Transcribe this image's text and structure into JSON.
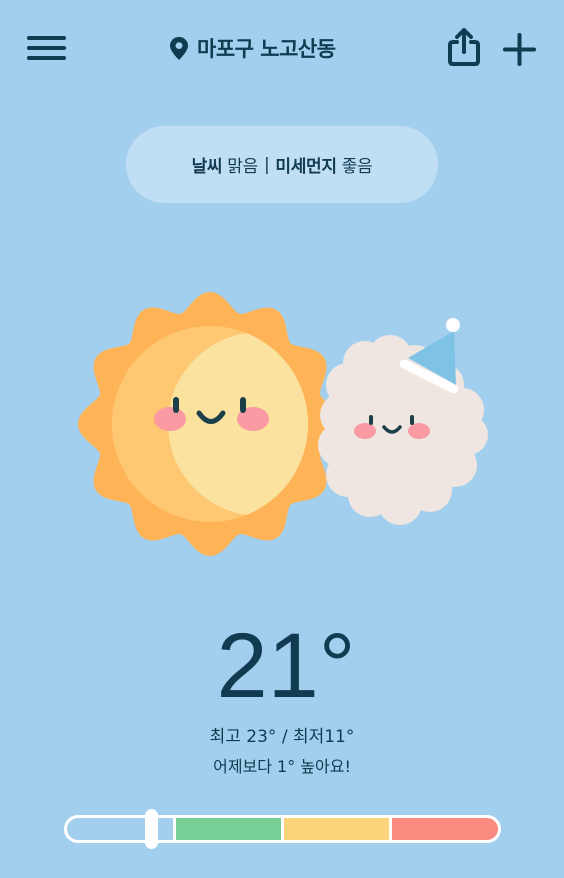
{
  "header": {
    "menu_icon": "hamburger-menu-icon",
    "location_icon": "map-pin-icon",
    "location": "마포구 노고산동",
    "share_icon": "share-icon",
    "add_icon": "plus-icon"
  },
  "status": {
    "weather_label": "날씨",
    "weather_value": "맑음",
    "separator": "|",
    "dust_label": "미세먼지",
    "dust_value": "좋음"
  },
  "current": {
    "temperature": "21°",
    "range": "최고 23° / 최저11°",
    "comparison": "어제보다 1° 높아요!"
  },
  "dust_scale": {
    "level_fraction": 0.198,
    "segment_colors": [
      "#a3cfee",
      "#76d095",
      "#fdd47a",
      "#f98b80"
    ]
  },
  "colors": {
    "background": "#a3cfee",
    "text": "#103b50",
    "pill": "#c0def4"
  }
}
